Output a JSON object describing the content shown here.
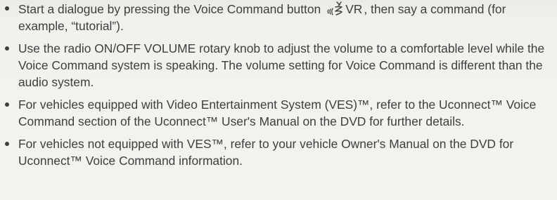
{
  "items": [
    {
      "before": "Start a dialogue by pressing the Voice Command button",
      "button_icon": "voice-command-icon",
      "button_label": "VR",
      "after": ", then say a command (for example, “tutorial”)."
    },
    {
      "text": "Use the radio ON/OFF VOLUME rotary knob to adjust the volume to a comfortable level while the Voice Command system is speaking. The volume setting for Voice Command is different than the audio system."
    },
    {
      "text": "For vehicles equipped with Video Entertainment System (VES)™, refer to the Uconnect™ Voice Command section of the Uconnect™ User's Manual on the DVD for further details."
    },
    {
      "text": "For vehicles not equipped with VES™, refer to your vehicle Owner's Manual on the DVD for Uconnect™ Voice Command information."
    }
  ]
}
